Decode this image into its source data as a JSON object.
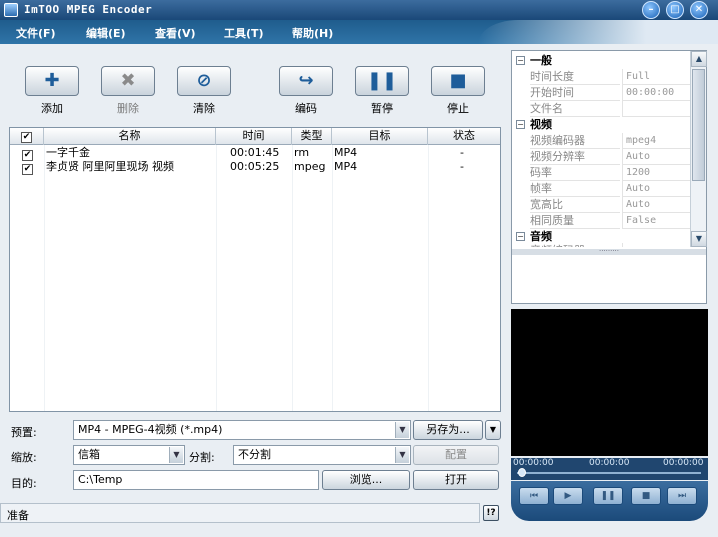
{
  "window": {
    "title": "ImTOO MPEG Encoder"
  },
  "menu": [
    "文件(F)",
    "编辑(E)",
    "查看(V)",
    "工具(T)",
    "帮助(H)"
  ],
  "toolbar": {
    "add": "添加",
    "delete": "删除",
    "clear": "清除",
    "encode": "编码",
    "pause": "暂停",
    "stop": "停止"
  },
  "filelist": {
    "columns": {
      "check": "☑",
      "name": "名称",
      "time": "时间",
      "type": "类型",
      "target": "目标",
      "status": "状态"
    },
    "rows": [
      {
        "checked": "✔",
        "name": "一字千金",
        "time": "00:01:45",
        "type": "rm",
        "target": "MP4",
        "status": "-"
      },
      {
        "checked": "✔",
        "name": "李贞贤 阿里阿里现场 视频",
        "time": "00:05:25",
        "type": "mpeg",
        "target": "MP4",
        "status": "-"
      }
    ]
  },
  "form": {
    "preset_label": "预置:",
    "preset_value": "MP4 - MPEG-4视频 (*.mp4)",
    "save_as": "另存为...",
    "zoom_label": "缩放:",
    "zoom_value": "信箱",
    "split_label": "分割:",
    "split_value": "不分割",
    "config": "配置",
    "dest_label": "目的:",
    "dest_value": "C:\\Temp",
    "browse": "浏览...",
    "open": "打开"
  },
  "status": {
    "text": "准备",
    "help": "!?"
  },
  "properties": {
    "groups": [
      {
        "title": "一般",
        "items": [
          {
            "key": "时间长度",
            "value": "Full"
          },
          {
            "key": "开始时间",
            "value": "00:00:00"
          },
          {
            "key": "文件名",
            "value": ""
          }
        ]
      },
      {
        "title": "视频",
        "items": [
          {
            "key": "视频编码器",
            "value": "mpeg4"
          },
          {
            "key": "视频分辨率",
            "value": "Auto"
          },
          {
            "key": "码率",
            "value": "1200"
          },
          {
            "key": "帧率",
            "value": "Auto"
          },
          {
            "key": "宽高比",
            "value": "Auto"
          },
          {
            "key": "相同质量",
            "value": "False"
          }
        ]
      },
      {
        "title": "音频",
        "items": [
          {
            "key": "音频编码器",
            "value": "..."
          }
        ]
      }
    ]
  },
  "player": {
    "time_start": "00:00:00",
    "time_mid": "00:00:00",
    "time_end": "00:00:00"
  },
  "colors": {
    "title_bg": "#1a4878",
    "menu_bg": "#1f5c8d",
    "panel_bg": "#e9eef3"
  }
}
